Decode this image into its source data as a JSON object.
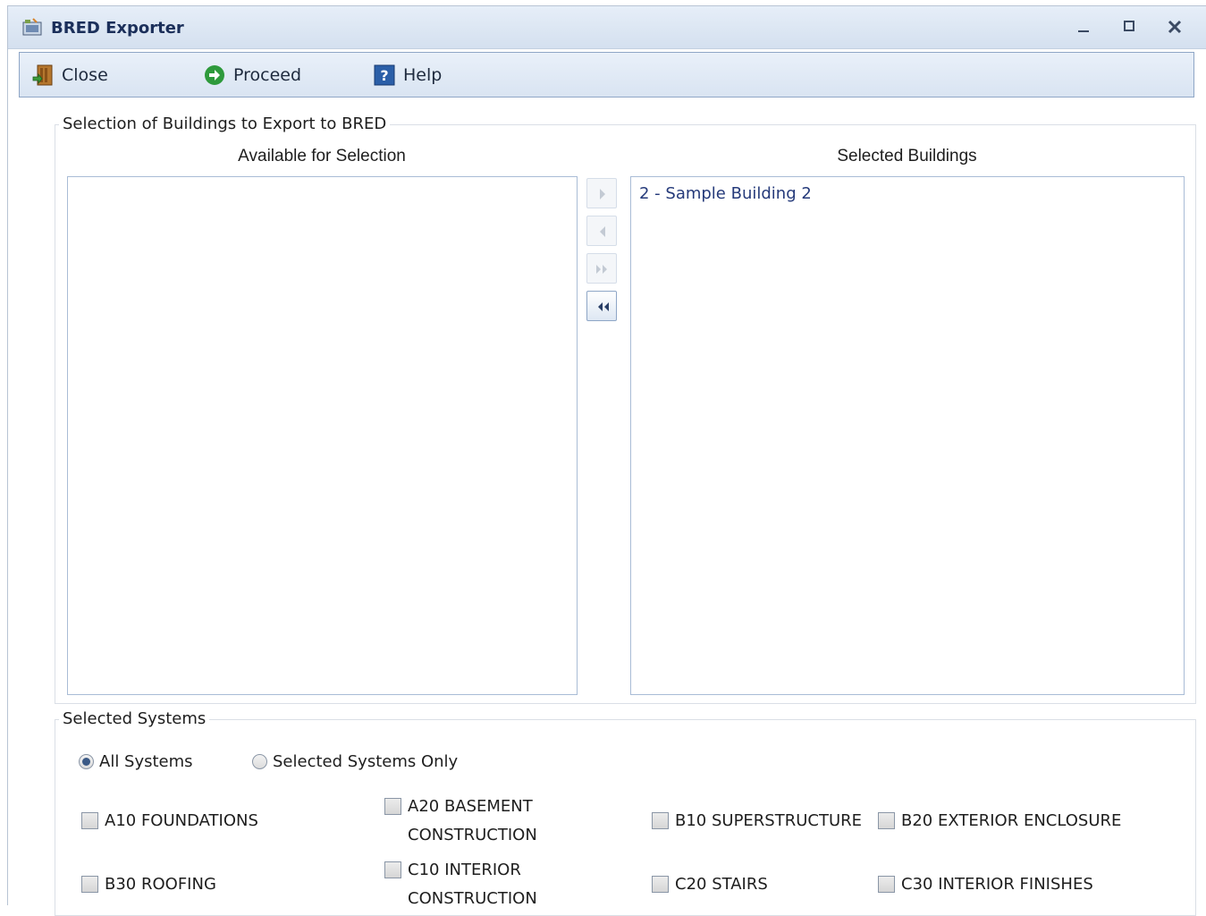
{
  "window": {
    "title": "BRED Exporter"
  },
  "toolbar": {
    "close_label": "Close",
    "proceed_label": "Proceed",
    "help_label": "Help"
  },
  "buildings_group": {
    "legend": "Selection of Buildings to Export to BRED",
    "available_header": "Available for Selection",
    "selected_header": "Selected Buildings",
    "available_items": [],
    "selected_items": [
      "2 - Sample Building 2"
    ]
  },
  "systems_group": {
    "legend": "Selected Systems",
    "radio_all": "All Systems",
    "radio_selected_only": "Selected Systems Only",
    "selected_radio": "All Systems",
    "checkboxes": [
      {
        "label": "A10 FOUNDATIONS",
        "checked": false
      },
      {
        "label": "A20 BASEMENT CONSTRUCTION",
        "checked": false
      },
      {
        "label": "B10 SUPERSTRUCTURE",
        "checked": false
      },
      {
        "label": "B20 EXTERIOR ENCLOSURE",
        "checked": false
      },
      {
        "label": "B30 ROOFING",
        "checked": false
      },
      {
        "label": "C10 INTERIOR CONSTRUCTION",
        "checked": false
      },
      {
        "label": "C20 STAIRS",
        "checked": false
      },
      {
        "label": "C30 INTERIOR FINISHES",
        "checked": false
      }
    ]
  },
  "colors": {
    "title_text": "#1b2f5a",
    "list_item_text": "#253a7a",
    "proceed_icon": "#2e9a3c",
    "help_icon": "#2b5fa8"
  }
}
